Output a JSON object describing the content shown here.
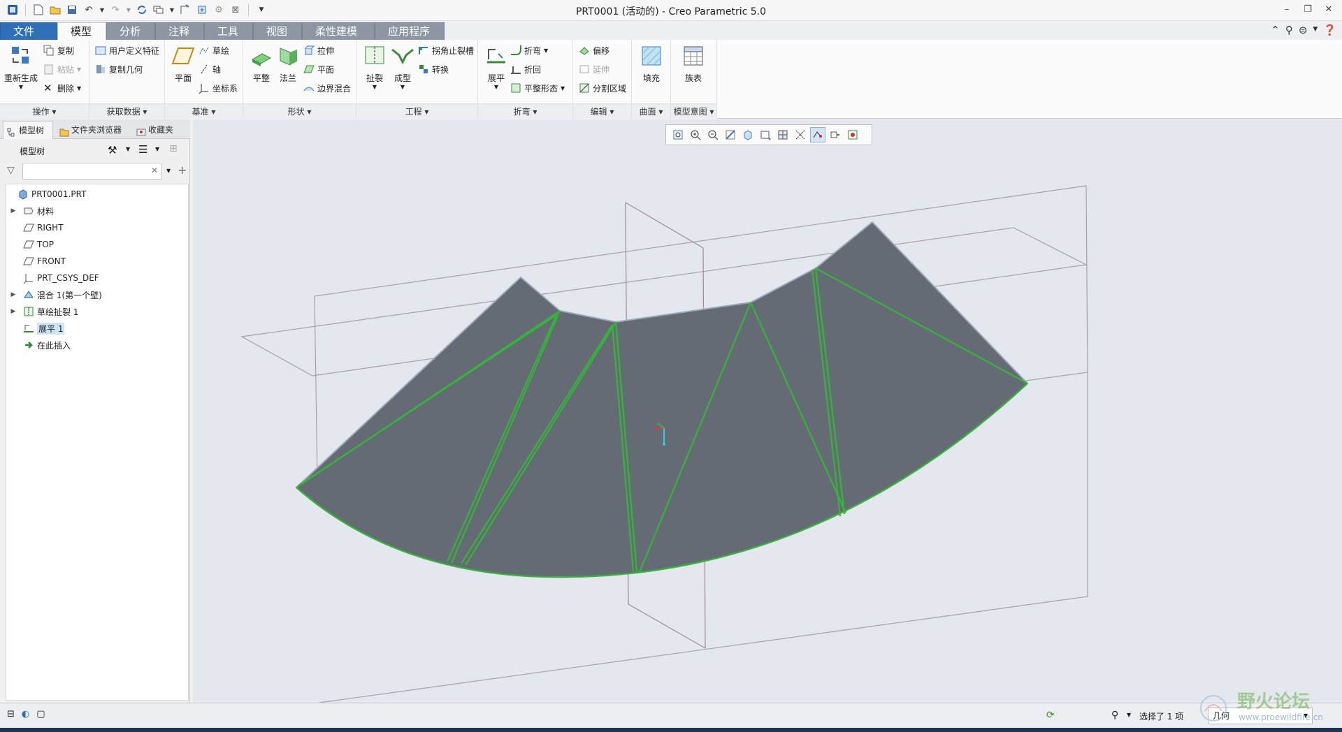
{
  "window": {
    "title": "PRT0001 (活动的) - Creo Parametric 5.0"
  },
  "tabs": [
    {
      "label": "文件",
      "kind": "file"
    },
    {
      "label": "模型",
      "kind": "active"
    },
    {
      "label": "分析"
    },
    {
      "label": "注释"
    },
    {
      "label": "工具"
    },
    {
      "label": "视图"
    },
    {
      "label": "柔性建模"
    },
    {
      "label": "应用程序"
    }
  ],
  "ribbon": {
    "groups": {
      "operations": "操作",
      "get_data": "获取数据",
      "datum": "基准",
      "shapes": "形状",
      "engineering": "工程",
      "bends": "折弯",
      "editing": "编辑",
      "surfaces": "曲面",
      "model_intent": "模型意图"
    },
    "operations": {
      "regenerate": "重新生成",
      "copy": "复制",
      "paste": "粘贴",
      "delete": "删除"
    },
    "get_data": {
      "udf": "用户定义特征",
      "copy_geom": "复制几何"
    },
    "datum": {
      "plane": "平面",
      "sketch": "草绘",
      "axis": "轴",
      "csys": "坐标系"
    },
    "shapes": {
      "planar": "平整",
      "flange": "法兰",
      "extrude": "拉伸",
      "plane2": "平面",
      "boundary": "边界混合"
    },
    "engineering": {
      "rip": "扯裂",
      "form": "成型",
      "corner_relief": "拐角止裂槽",
      "convert": "转换"
    },
    "bends": {
      "unbend": "展平",
      "bend": "折弯",
      "bend_back": "折回",
      "flat_pattern": "平整形态"
    },
    "editing": {
      "offset": "偏移",
      "extend": "延伸",
      "split": "分割区域"
    },
    "surfaces": {
      "fill": "填充"
    },
    "model_intent": {
      "family_table": "族表"
    }
  },
  "leftpanel": {
    "tabs": [
      "模型树",
      "文件夹浏览器",
      "收藏夹"
    ],
    "header": "模型树",
    "filter_placeholder": "",
    "tree": [
      {
        "label": "PRT0001.PRT",
        "icon": "part-icon",
        "level": 0,
        "expand": ""
      },
      {
        "label": "材料",
        "icon": "material-icon",
        "level": 1,
        "expand": "▶"
      },
      {
        "label": "RIGHT",
        "icon": "datum-plane-icon",
        "level": 1,
        "expand": ""
      },
      {
        "label": "TOP",
        "icon": "datum-plane-icon",
        "level": 1,
        "expand": ""
      },
      {
        "label": "FRONT",
        "icon": "datum-plane-icon",
        "level": 1,
        "expand": ""
      },
      {
        "label": "PRT_CSYS_DEF",
        "icon": "csys-icon",
        "level": 1,
        "expand": ""
      },
      {
        "label": "混合 1(第一个壁)",
        "icon": "blend-icon",
        "level": 1,
        "expand": "▶"
      },
      {
        "label": "草绘扯裂 1",
        "icon": "sketch-rip-icon",
        "level": 1,
        "expand": "▶"
      },
      {
        "label": "展平 1",
        "icon": "unbend-icon",
        "level": 1,
        "expand": "",
        "selected": true
      },
      {
        "label": "在此插入",
        "icon": "insert-here-icon",
        "level": 1,
        "expand": ""
      }
    ]
  },
  "status": {
    "selection": "选择了 1 项",
    "filter": "几何"
  },
  "watermark": {
    "title": "野火论坛",
    "url": "www.proewildfire.cn"
  },
  "colors": {
    "accent": "#2e6fb7",
    "surface": "#656b75",
    "edge": "#34b538"
  }
}
